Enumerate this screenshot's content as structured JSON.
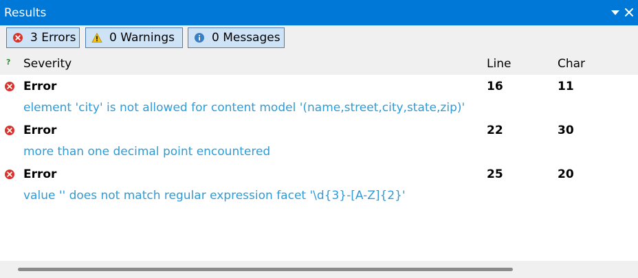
{
  "titlebar": {
    "title": "Results",
    "dropdown_icon": "dropdown-arrow-icon",
    "close_icon": "close-icon"
  },
  "filters": {
    "errors_label": "3 Errors",
    "warnings_label": "0 Warnings",
    "messages_label": "0 Messages"
  },
  "columns": {
    "help": "?",
    "severity": "Severity",
    "line": "Line",
    "char": "Char"
  },
  "rows": [
    {
      "severity": "Error",
      "line": "16",
      "char": "11",
      "message": "element 'city' is not allowed for content model '(name,street,city,state,zip)'"
    },
    {
      "severity": "Error",
      "line": "22",
      "char": "30",
      "message": "more than one decimal point encountered"
    },
    {
      "severity": "Error",
      "line": "25",
      "char": "20",
      "message": "value '' does not match regular expression facet '\\d{3}-[A-Z]{2}'"
    }
  ],
  "colors": {
    "titlebar": "#0078d7",
    "message_text": "#2e9bd6",
    "error_icon": "#d9342b",
    "warning_icon": "#f2c318",
    "info_icon": "#3a7fc2"
  }
}
